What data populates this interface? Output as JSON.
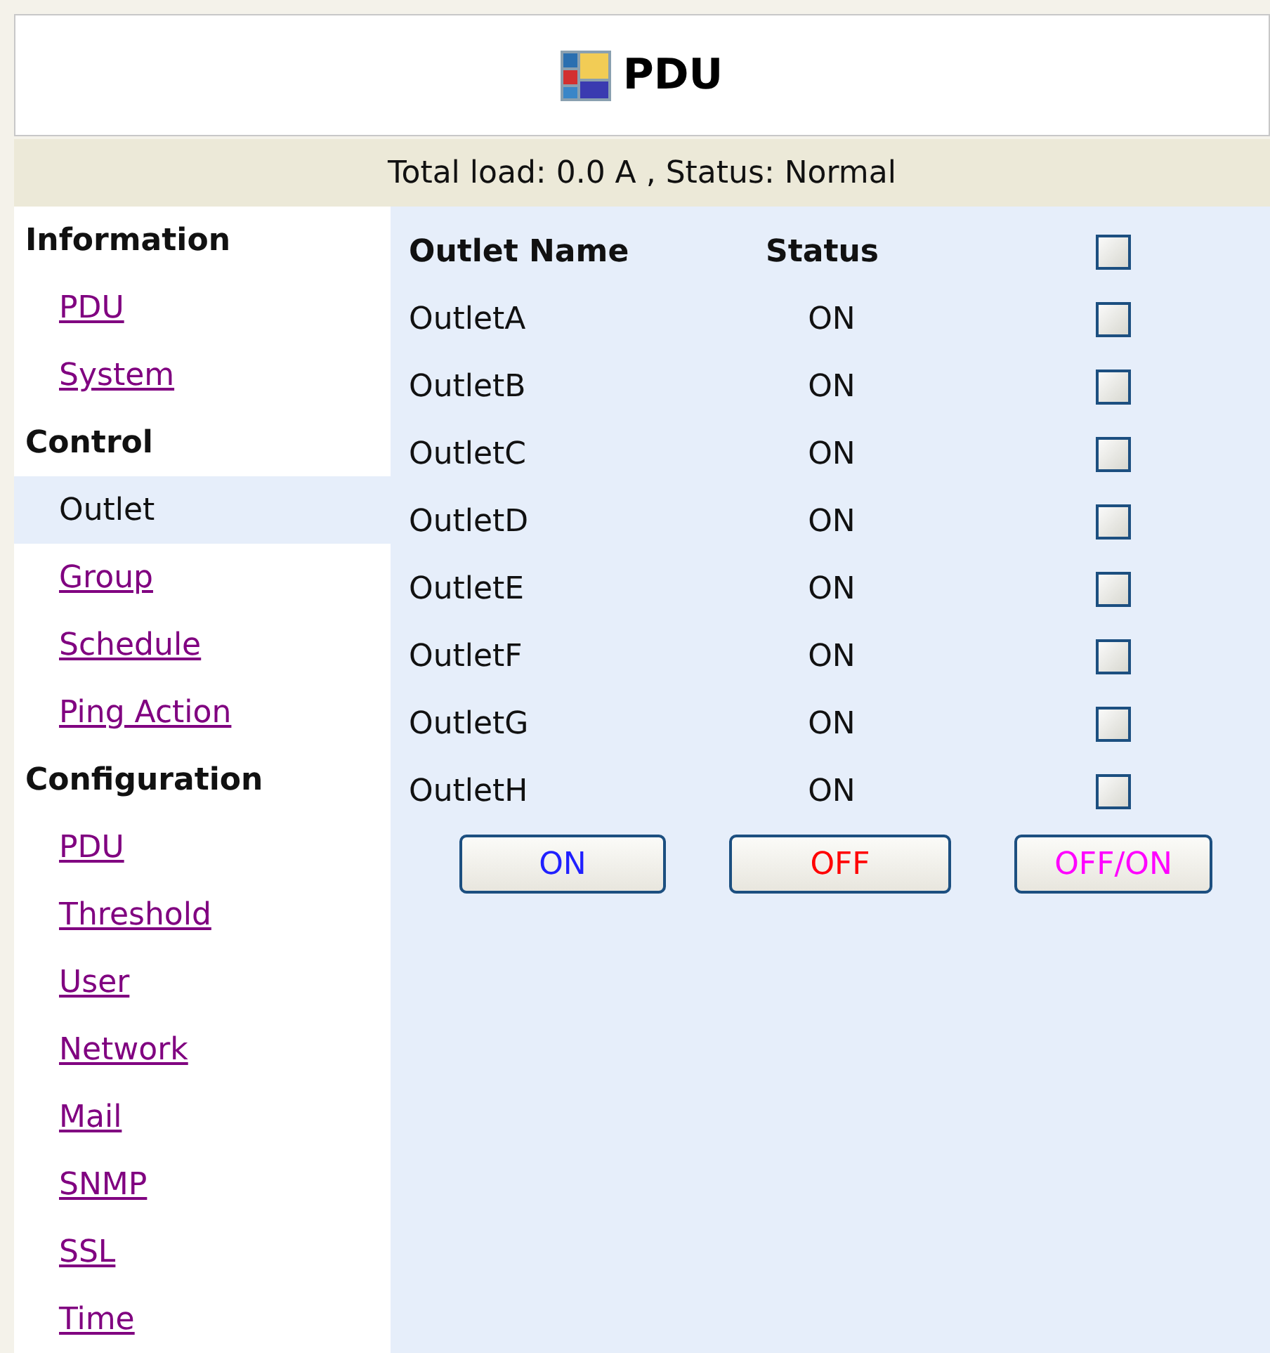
{
  "header": {
    "title": "PDU"
  },
  "status_bar": "Total load: 0.0 A , Status: Normal",
  "sidebar": [
    {
      "heading": "Information",
      "items": [
        {
          "label": "PDU",
          "selected": false
        },
        {
          "label": "System",
          "selected": false
        }
      ]
    },
    {
      "heading": "Control",
      "items": [
        {
          "label": "Outlet",
          "selected": true
        },
        {
          "label": "Group",
          "selected": false
        },
        {
          "label": "Schedule",
          "selected": false
        },
        {
          "label": "Ping Action",
          "selected": false
        }
      ]
    },
    {
      "heading": "Configuration",
      "items": [
        {
          "label": "PDU",
          "selected": false
        },
        {
          "label": "Threshold",
          "selected": false
        },
        {
          "label": "User",
          "selected": false
        },
        {
          "label": "Network",
          "selected": false
        },
        {
          "label": "Mail",
          "selected": false
        },
        {
          "label": "SNMP",
          "selected": false
        },
        {
          "label": "SSL",
          "selected": false
        },
        {
          "label": "Time",
          "selected": false
        }
      ]
    }
  ],
  "table": {
    "columns": [
      "Outlet Name",
      "Status"
    ],
    "select_all_checked": false,
    "rows": [
      {
        "name": "OutletA",
        "status": "ON",
        "checked": false
      },
      {
        "name": "OutletB",
        "status": "ON",
        "checked": false
      },
      {
        "name": "OutletC",
        "status": "ON",
        "checked": false
      },
      {
        "name": "OutletD",
        "status": "ON",
        "checked": false
      },
      {
        "name": "OutletE",
        "status": "ON",
        "checked": false
      },
      {
        "name": "OutletF",
        "status": "ON",
        "checked": false
      },
      {
        "name": "OutletG",
        "status": "ON",
        "checked": false
      },
      {
        "name": "OutletH",
        "status": "ON",
        "checked": false
      }
    ]
  },
  "buttons": [
    {
      "label": "ON",
      "color": "#2020ff"
    },
    {
      "label": "OFF",
      "color": "#ff0000"
    },
    {
      "label": "OFF/ON",
      "color": "#ff00ff"
    }
  ]
}
